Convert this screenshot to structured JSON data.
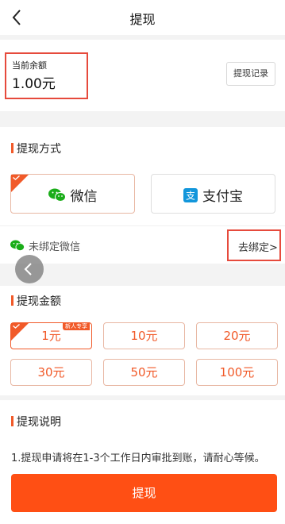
{
  "nav": {
    "title": "提现",
    "back_icon": "chevron-left-icon"
  },
  "balance": {
    "label": "当前余额",
    "value": "1.00元",
    "record_button": "提现记录"
  },
  "method": {
    "title": "提现方式",
    "options": [
      {
        "label": "微信",
        "icon": "wechat-icon",
        "color": "#1aad19",
        "selected": true
      },
      {
        "label": "支付宝",
        "icon": "alipay-icon",
        "color": "#1296db",
        "selected": false
      }
    ],
    "bind_status": "未绑定微信",
    "bind_link": "去绑定>"
  },
  "amount": {
    "title": "提现金额",
    "new_badge": "新人专享",
    "options": [
      "1元",
      "10元",
      "20元",
      "30元",
      "50元",
      "100元"
    ],
    "selected_index": 0
  },
  "description": {
    "title": "提现说明",
    "text": "1.提现申请将在1-3个工作日内审批到账，请耐心等候。"
  },
  "submit": {
    "label": "提现"
  },
  "colors": {
    "accent": "#f15a29",
    "button": "#ff4f14",
    "highlight_box": "#e64a3c"
  }
}
